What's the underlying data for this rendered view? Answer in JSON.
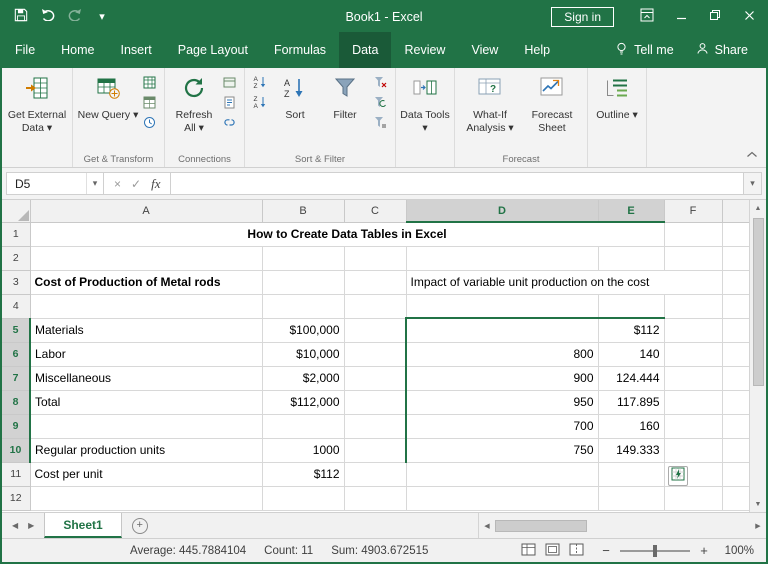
{
  "icons": {
    "dropdown": "▾",
    "cancel": "×",
    "enter": "✓",
    "up_arrow": "▲",
    "down_arrow": "▼",
    "left_arrow": "◀",
    "right_arrow": "▶",
    "plus": "+",
    "minus": "−"
  },
  "title_bar": {
    "title": "Book1  -  Excel",
    "sign_in_label": "Sign in"
  },
  "ribbon_tabs": {
    "items": [
      {
        "label": "File"
      },
      {
        "label": "Home"
      },
      {
        "label": "Insert"
      },
      {
        "label": "Page Layout"
      },
      {
        "label": "Formulas"
      },
      {
        "label": "Data"
      },
      {
        "label": "Review"
      },
      {
        "label": "View"
      },
      {
        "label": "Help"
      }
    ],
    "active": "Data",
    "tell_me_label": "Tell me",
    "share_label": "Share"
  },
  "ribbon": {
    "get_external": {
      "label": "Get External Data ▾"
    },
    "get_transform": {
      "new_query_label": "New Query ▾",
      "group_label": "Get & Transform"
    },
    "connections": {
      "refresh_label": "Refresh All ▾",
      "group_label": "Connections"
    },
    "sort_filter": {
      "sort_label": "Sort",
      "filter_label": "Filter",
      "group_label": "Sort & Filter"
    },
    "data_tools": {
      "label": "Data Tools ▾"
    },
    "forecast": {
      "whatif_label": "What-If Analysis ▾",
      "forecast_sheet_label": "Forecast Sheet",
      "group_label": "Forecast"
    },
    "outline": {
      "label": "Outline ▾"
    }
  },
  "formula_bar": {
    "name_box_value": "D5",
    "fx_label": "fx",
    "formula_value": ""
  },
  "grid": {
    "col_headers": [
      "A",
      "B",
      "C",
      "D",
      "E",
      "F"
    ],
    "row_numbers": [
      "1",
      "2",
      "3",
      "4",
      "5",
      "6",
      "7",
      "8",
      "9",
      "10",
      "11",
      "12"
    ],
    "cells": {
      "title": "How to Create Data Tables in Excel",
      "a3": "Cost of Production of Metal rods",
      "d3": "Impact of variable unit production on the cost",
      "a5": "Materials",
      "b5": "$100,000",
      "e5": "$112",
      "a6": "Labor",
      "b6": "$10,000",
      "d6": "800",
      "e6": "140",
      "a7": "Miscellaneous",
      "b7": "$2,000",
      "d7": "900",
      "e7": "124.444",
      "a8": "Total",
      "b8": "$112,000",
      "d8": "950",
      "e8": "117.895",
      "d9": "700",
      "e9": "160",
      "a10": "Regular production units",
      "b10": "1000",
      "d10": "750",
      "e10": "149.333",
      "a11": "Cost per unit",
      "b11": "$112"
    }
  },
  "sheet_tabs": {
    "active_label": "Sheet1"
  },
  "status_bar": {
    "average_label": "Average: 445.7884104",
    "count_label": "Count: 11",
    "sum_label": "Sum: 4903.672515",
    "zoom_level": "100%"
  },
  "colors": {
    "excel_green": "#217346",
    "selection_fill": "#D4D4D4",
    "yellow_fill": "#FFFF00",
    "orange_fill": "#FFC000",
    "lavender_fill": "#D9E1F2",
    "gray_label_fill": "#D9D9D9",
    "title_text_blue": "#2E75B6"
  }
}
